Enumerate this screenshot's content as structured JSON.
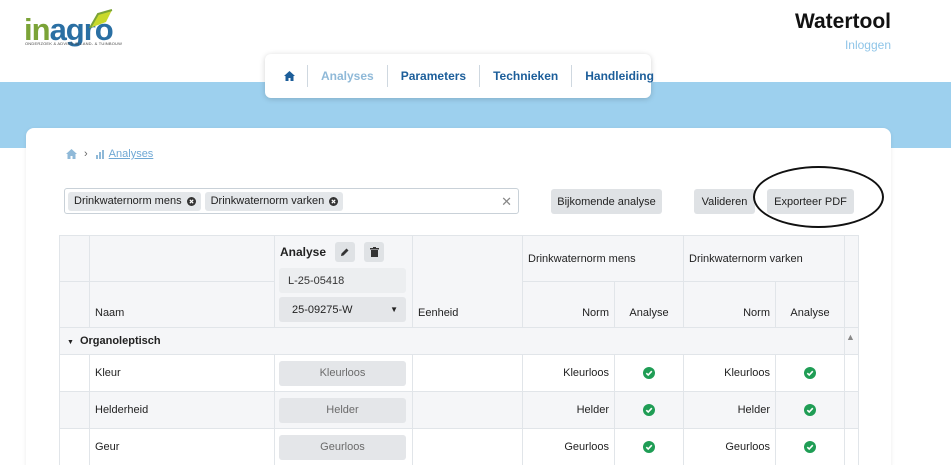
{
  "brand": {
    "logo_text_a": "in",
    "logo_text_b": "agro",
    "logo_tagline": "ONDERZOEK & ADVIES IN LAND- & TUINBOUW",
    "brand_green": "#7ba337",
    "brand_blue": "#2a6fa3"
  },
  "header": {
    "app_title": "Watertool",
    "login_label": "Inloggen"
  },
  "nav": {
    "home_icon": "home-icon",
    "items": [
      {
        "label": "Analyses",
        "active": true
      },
      {
        "label": "Parameters",
        "active": false
      },
      {
        "label": "Technieken",
        "active": false
      },
      {
        "label": "Handleiding",
        "active": false
      }
    ]
  },
  "breadcrumb": {
    "home_icon": "home-icon",
    "current_icon": "chart-icon",
    "current_label": "Analyses"
  },
  "filter": {
    "chips": [
      "Drinkwaternorm mens",
      "Drinkwaternorm varken"
    ],
    "clear_icon": "close-icon"
  },
  "toolbar": {
    "extra_analysis": "Bijkomende analyse",
    "validate": "Valideren",
    "export_pdf": "Exporteer PDF"
  },
  "table": {
    "analysis_header": "Analyse",
    "analysis_id": "L-25-05418",
    "sample_select": "25-09275-W",
    "col_name": "Naam",
    "col_unit": "Eenheid",
    "norm_groups": [
      "Drinkwaternorm mens",
      "Drinkwaternorm varken"
    ],
    "sub_norm": "Norm",
    "sub_analysis": "Analyse",
    "group_label": "Organoleptisch",
    "rows": [
      {
        "name": "Kleur",
        "value": "Kleurloos",
        "norm1": "Kleurloos",
        "norm2": "Kleurloos"
      },
      {
        "name": "Helderheid",
        "value": "Helder",
        "norm1": "Helder",
        "norm2": "Helder"
      },
      {
        "name": "Geur",
        "value": "Geurloos",
        "norm1": "Geurloos",
        "norm2": "Geurloos"
      }
    ]
  },
  "colors": {
    "accent_blue": "#9dd0ee",
    "check_green": "#1f9d55"
  }
}
